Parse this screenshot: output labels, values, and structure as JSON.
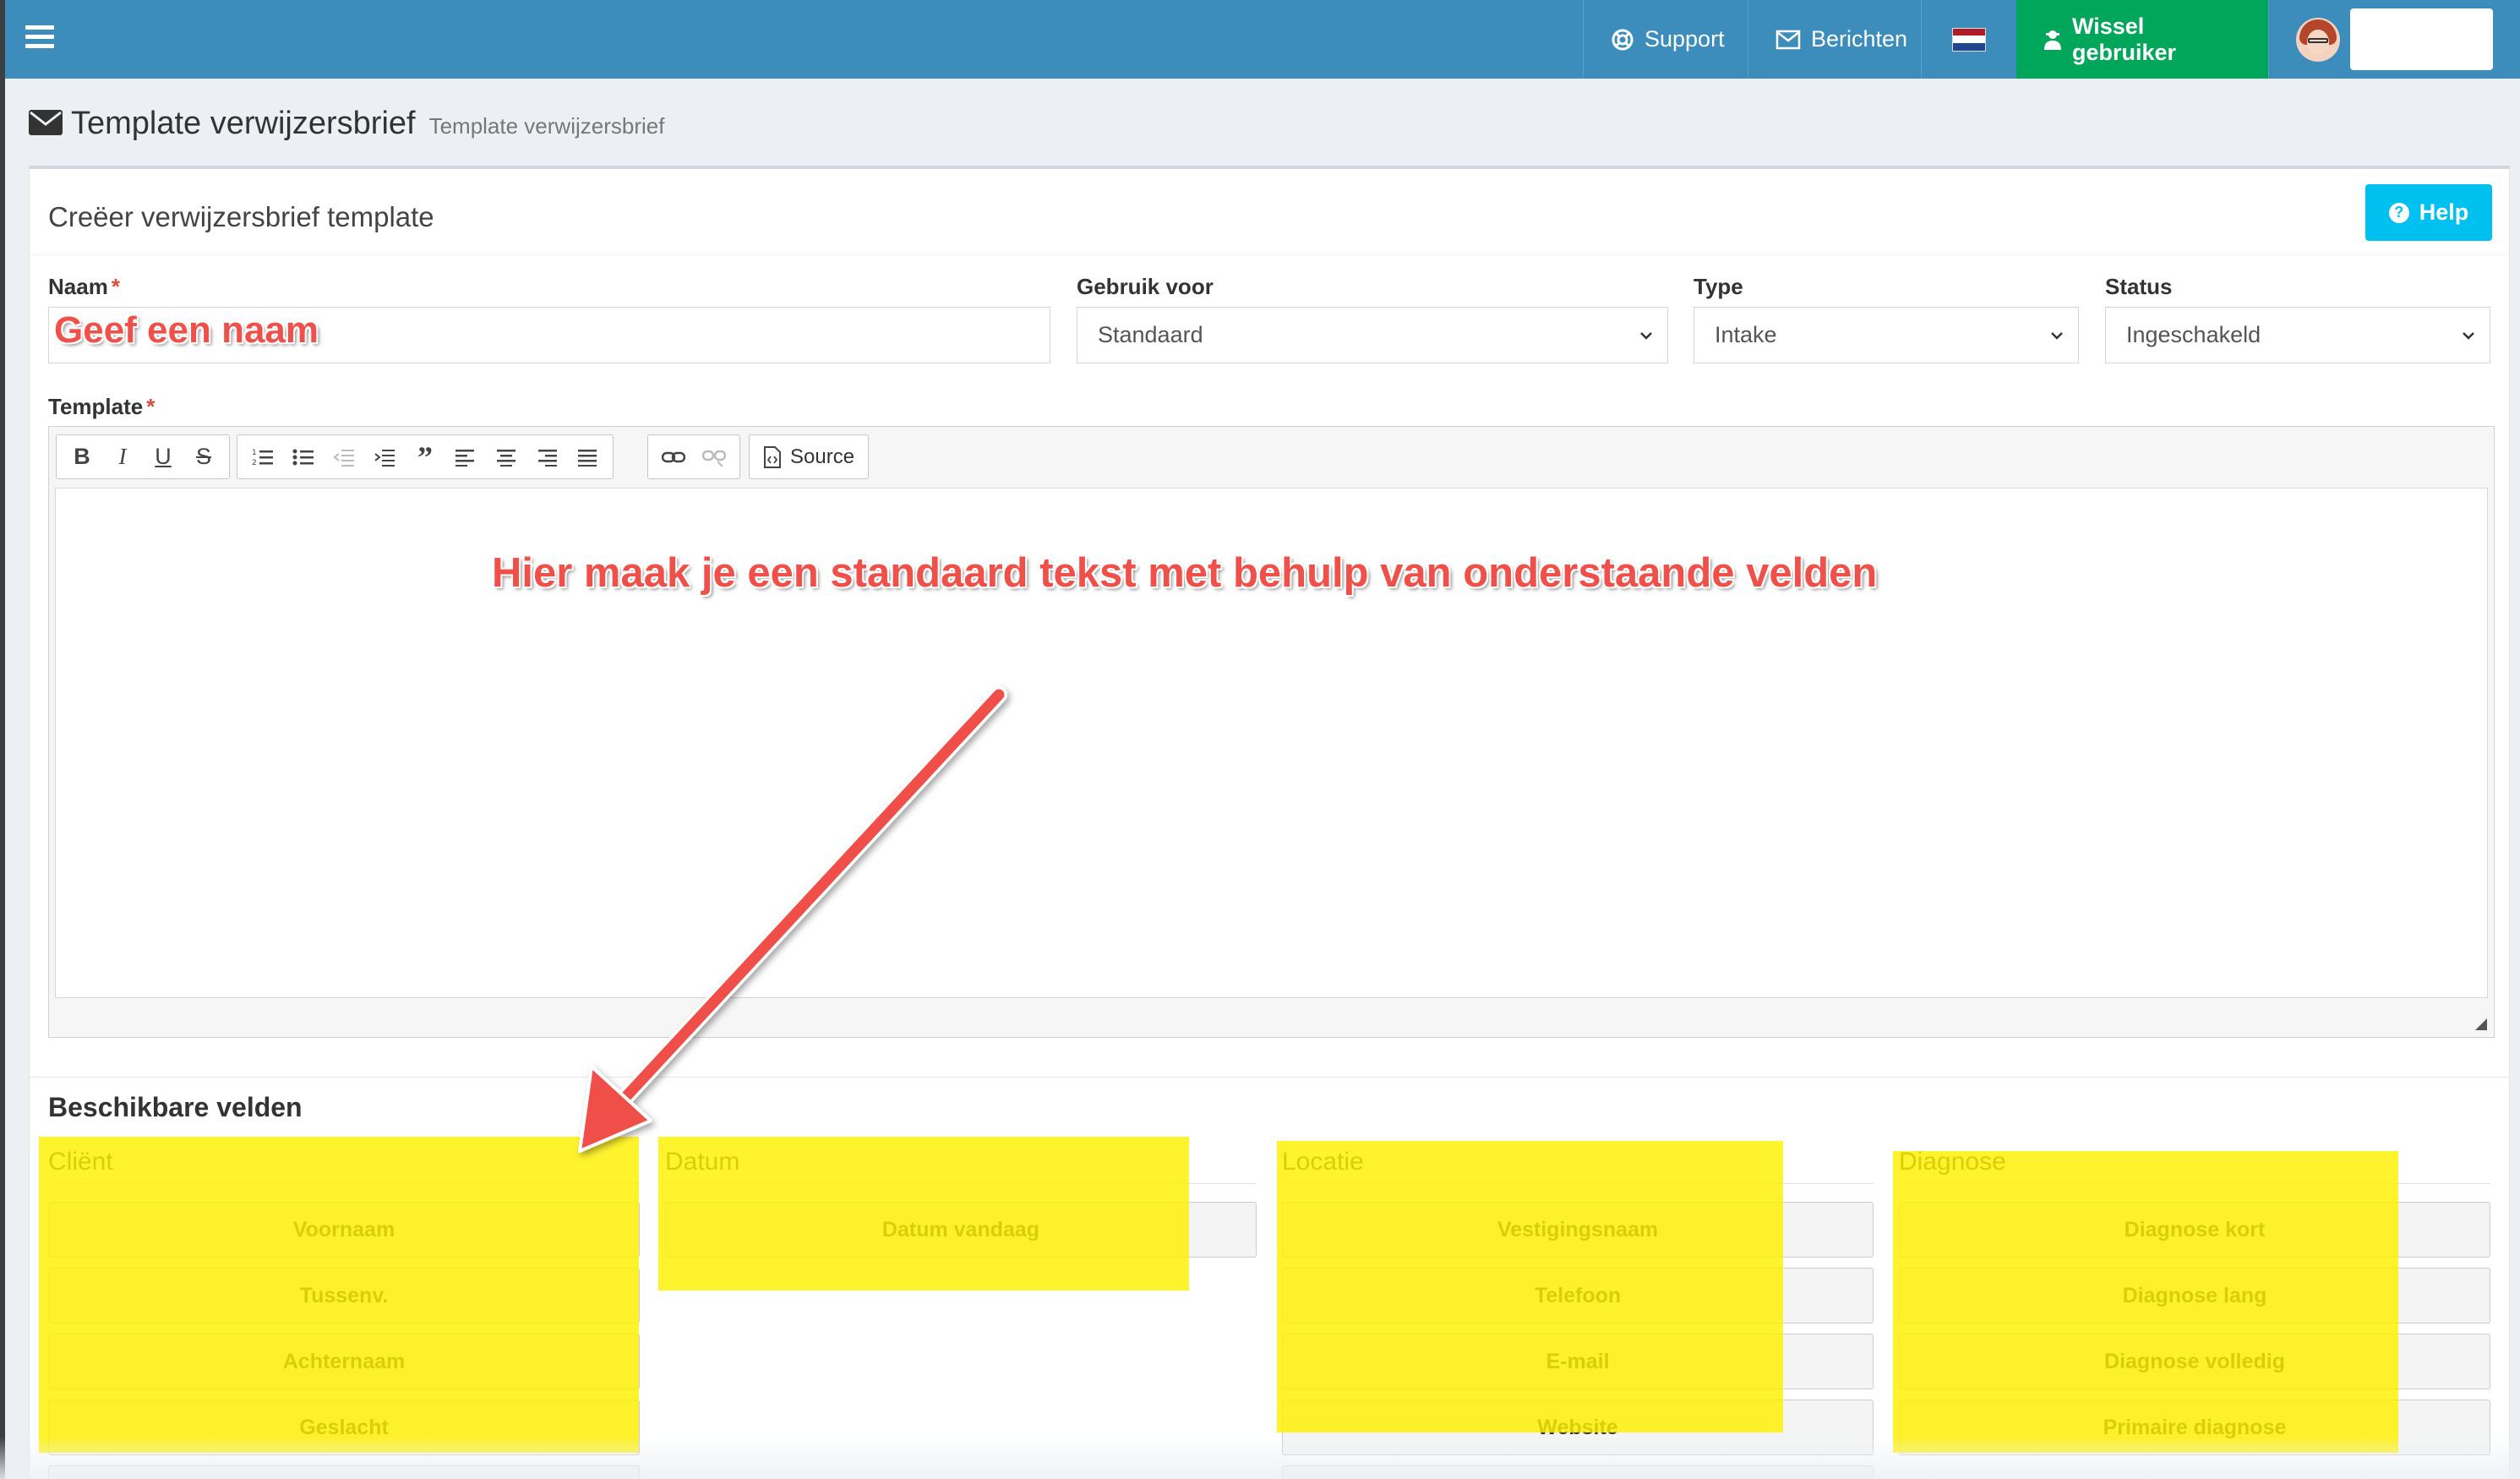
{
  "navbar": {
    "support": "Support",
    "messages": "Berichten",
    "switch_user": "Wissel gebruiker",
    "flag": "netherlands-flag",
    "colors": {
      "bar": "#3c8dbc",
      "switch": "#00a65a"
    }
  },
  "page": {
    "title": "Template verwijzersbrief",
    "subtitle": "Template verwijzersbrief"
  },
  "box": {
    "title": "Creëer verwijzersbrief template",
    "help": "Help"
  },
  "form": {
    "name_label": "Naam",
    "name_value": "",
    "use_for_label": "Gebruik voor",
    "use_for_value": "Standaard",
    "type_label": "Type",
    "type_value": "Intake",
    "status_label": "Status",
    "status_value": "Ingeschakeld",
    "template_label": "Template",
    "required_mark": "*"
  },
  "editor": {
    "toolbar": [
      "bold",
      "italic",
      "underline",
      "strikethrough",
      "numbered-list",
      "bulleted-list",
      "outdent",
      "indent",
      "blockquote",
      "align-left",
      "align-center",
      "align-right",
      "justify",
      "link",
      "unlink"
    ],
    "source_label": "Source"
  },
  "annotations": {
    "name_hint": "Geef een naam",
    "editor_hint": "Hier maak je een standaard tekst met behulp van onderstaande velden",
    "highlight_color": "#fff000",
    "arrow_color": "#f0504a"
  },
  "fields": {
    "title": "Beschikbare velden",
    "columns": [
      {
        "heading": "Cliënt",
        "buttons": [
          "Voornaam",
          "Tussenv.",
          "Achternaam",
          "Geslacht"
        ]
      },
      {
        "heading": "Datum",
        "buttons": [
          "Datum vandaag"
        ]
      },
      {
        "heading": "Locatie",
        "buttons": [
          "Vestigingsnaam",
          "Telefoon",
          "E-mail",
          "Website"
        ]
      },
      {
        "heading": "Diagnose",
        "buttons": [
          "Diagnose kort",
          "Diagnose lang",
          "Diagnose volledig",
          "Primaire diagnose"
        ]
      }
    ]
  }
}
